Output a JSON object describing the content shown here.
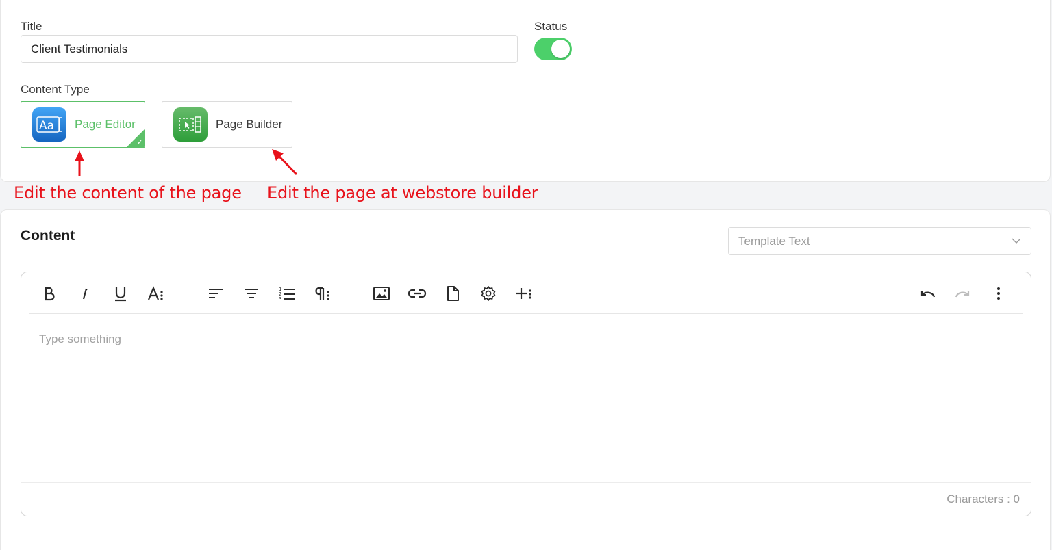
{
  "form": {
    "title_label": "Title",
    "title_value": "Client Testimonials",
    "status_label": "Status",
    "status_on": true,
    "content_type_label": "Content Type",
    "content_types": [
      {
        "label": "Page Editor",
        "selected": true,
        "icon": "text-aa-icon",
        "color": "#1e88e5"
      },
      {
        "label": "Page Builder",
        "selected": false,
        "icon": "page-builder-icon",
        "color": "#43a047"
      }
    ]
  },
  "annotations": {
    "editor_note": "Edit the content of the page",
    "builder_note": "Edit the page at webstore builder",
    "color": "#e8121b"
  },
  "content": {
    "heading": "Content",
    "template_placeholder": "Template Text",
    "editor_placeholder": "Type something",
    "char_count": "Characters : 0"
  },
  "toolbar": {
    "buttons": [
      "bold-icon",
      "italic-icon",
      "underline-icon",
      "font-size-icon",
      "align-left-icon",
      "align-center-icon",
      "ordered-list-icon",
      "paragraph-icon",
      "image-icon",
      "link-icon",
      "file-icon",
      "gear-icon",
      "insert-more-icon",
      "undo-icon",
      "redo-icon",
      "more-vertical-icon"
    ]
  },
  "colors": {
    "accent_green": "#4cd06a",
    "selected_border": "#5cc069",
    "selected_text": "#5cc069"
  }
}
